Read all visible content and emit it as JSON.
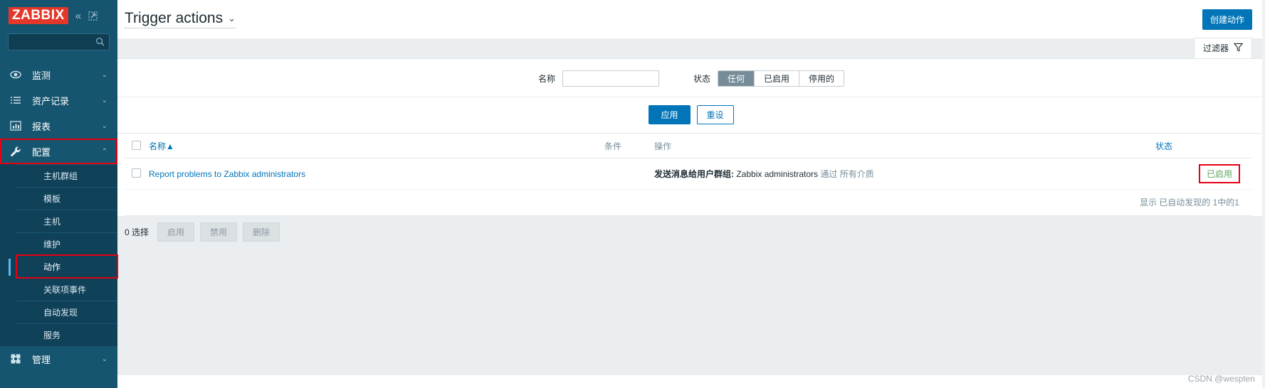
{
  "sidebar": {
    "logo": "ZABBIX",
    "collapse_icon": "chevron-double-left-icon",
    "hide_icon": "collapse-panel-icon",
    "search_placeholder": "",
    "search_value": "",
    "menu": [
      {
        "label": "监测",
        "icon": "eye-icon",
        "arrow": "chevron-down"
      },
      {
        "label": "资产记录",
        "icon": "list-icon",
        "arrow": "chevron-down"
      },
      {
        "label": "报表",
        "icon": "bar-chart-icon",
        "arrow": "chevron-down"
      },
      {
        "label": "配置",
        "icon": "wrench-icon",
        "arrow": "chevron-up"
      }
    ],
    "submenu": [
      {
        "label": "主机群组"
      },
      {
        "label": "模板"
      },
      {
        "label": "主机"
      },
      {
        "label": "维护"
      },
      {
        "label": "动作"
      },
      {
        "label": "关联项事件"
      },
      {
        "label": "自动发现"
      },
      {
        "label": "服务"
      }
    ],
    "bottom_menu": {
      "label": "管理",
      "icon": "gear-icon",
      "arrow": "chevron-down"
    }
  },
  "header": {
    "title": "Trigger actions",
    "title_chevron": "chevron-down-icon",
    "create_button": "创建动作"
  },
  "filter": {
    "tab_label": "过滤器",
    "tab_icon": "funnel-icon",
    "name_label": "名称",
    "name_value": "",
    "name_placeholder": "",
    "status_label": "状态",
    "status_options": [
      "任何",
      "已启用",
      "停用的"
    ],
    "status_selected": "任何",
    "apply_button": "应用",
    "reset_button": "重设"
  },
  "table": {
    "columns": {
      "name": "名称",
      "sort_arrow": "▲",
      "conditions": "条件",
      "operations": "操作",
      "status": "状态"
    },
    "rows": [
      {
        "name": "Report problems to Zabbix administrators",
        "conditions": "",
        "operation_label": "发送消息给用户群组:",
        "operation_target": "Zabbix administrators",
        "operation_via": "通过",
        "operation_media": "所有介质",
        "status": "已启用"
      }
    ],
    "footer": "显示 已自动发现的 1中的1"
  },
  "bulk": {
    "count_label": "0 选择",
    "enable_button": "启用",
    "disable_button": "禁用",
    "delete_button": "删除"
  },
  "watermark": "CSDN @wespten",
  "colors": {
    "sidebar_bg": "#16556f",
    "accent": "#0275b8",
    "logo_red": "#e3372a",
    "status_green": "#59a659",
    "highlight_red": "#e60012"
  }
}
